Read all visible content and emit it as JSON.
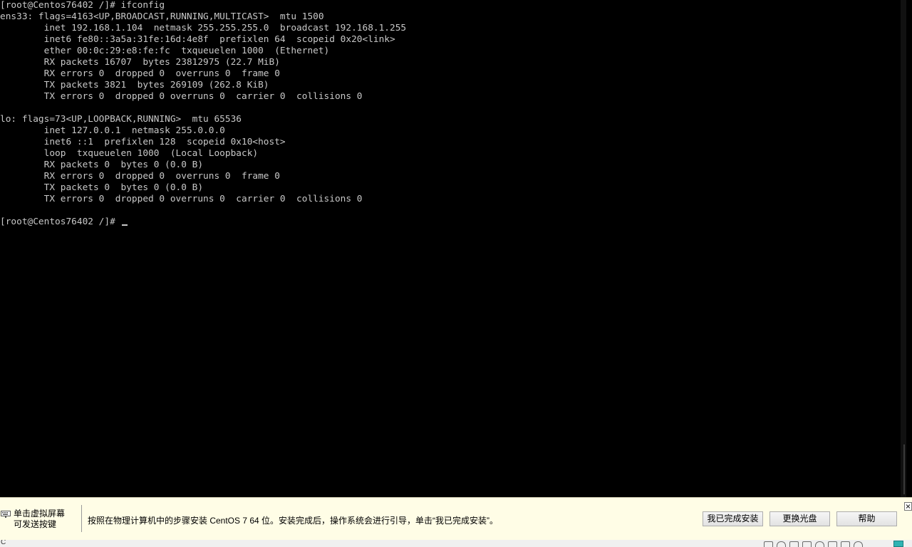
{
  "console": {
    "lines": [
      "[root@Centos76402 /]# ifconfig",
      "ens33: flags=4163<UP,BROADCAST,RUNNING,MULTICAST>  mtu 1500",
      "        inet 192.168.1.104  netmask 255.255.255.0  broadcast 192.168.1.255",
      "        inet6 fe80::3a5a:31fe:16d:4e8f  prefixlen 64  scopeid 0x20<link>",
      "        ether 00:0c:29:e8:fe:fc  txqueuelen 1000  (Ethernet)",
      "        RX packets 16707  bytes 23812975 (22.7 MiB)",
      "        RX errors 0  dropped 0  overruns 0  frame 0",
      "        TX packets 3821  bytes 269109 (262.8 KiB)",
      "        TX errors 0  dropped 0 overruns 0  carrier 0  collisions 0",
      "",
      "lo: flags=73<UP,LOOPBACK,RUNNING>  mtu 65536",
      "        inet 127.0.0.1  netmask 255.0.0.0",
      "        inet6 ::1  prefixlen 128  scopeid 0x10<host>",
      "        loop  txqueuelen 1000  (Local Loopback)",
      "        RX packets 0  bytes 0 (0.0 B)",
      "        RX errors 0  dropped 0  overruns 0  frame 0",
      "        TX packets 0  bytes 0 (0.0 B)",
      "        TX errors 0  dropped 0 overruns 0  carrier 0  collisions 0",
      "",
      "[root@Centos76402 /]# "
    ],
    "text_color": "#c8c8c8",
    "background": "#000000"
  },
  "hint_bar": {
    "left_line1": "单击虚拟屏幕",
    "left_line2": "可发送按键",
    "message": "按照在物理计算机中的步骤安装 CentOS 7 64 位。安装完成后，操作系统会进行引导，单击“我已完成安装”。",
    "done_button": "我已完成安装",
    "change_disc_button": "更换光盘",
    "help_button": "帮助",
    "background": "#fffde6"
  },
  "status_bar": {
    "left_text": "C",
    "icons": [
      "hdd-icon",
      "cdrom-icon",
      "network-icon",
      "usb-icon",
      "sound-icon",
      "printer-icon",
      "display-icon",
      "settings-icon"
    ],
    "accent_icon": "fullscreen-icon"
  }
}
